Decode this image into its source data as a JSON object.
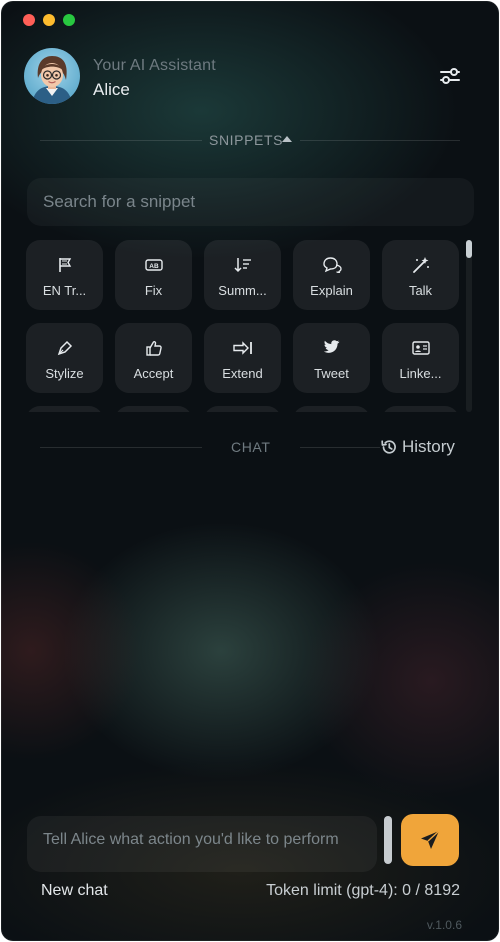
{
  "header": {
    "subtitle": "Your AI Assistant",
    "name": "Alice",
    "settings_icon": "sliders-icon"
  },
  "snippets": {
    "label": "SNIPPETS",
    "search_placeholder": "Search for a snippet",
    "items": [
      {
        "label": "EN Tr...",
        "icon": "flag-icon"
      },
      {
        "label": "Fix",
        "icon": "ab-icon"
      },
      {
        "label": "Summ...",
        "icon": "sort-icon"
      },
      {
        "label": "Explain",
        "icon": "chat-bubbles-icon"
      },
      {
        "label": "Talk",
        "icon": "magic-wand-icon"
      },
      {
        "label": "Stylize",
        "icon": "pen-icon"
      },
      {
        "label": "Accept",
        "icon": "thumbs-up-icon"
      },
      {
        "label": "Extend",
        "icon": "arrow-bar-right-icon"
      },
      {
        "label": "Tweet",
        "icon": "twitter-icon"
      },
      {
        "label": "Linke...",
        "icon": "id-card-icon"
      }
    ]
  },
  "chat": {
    "label": "CHAT",
    "history_label": "History",
    "input_placeholder": "Tell Alice what action you'd like to perform"
  },
  "footer": {
    "new_chat": "New chat",
    "token_limit": "Token limit (gpt-4): 0 / 8192",
    "version": "v.1.0.6"
  },
  "colors": {
    "accent": "#f0a53a",
    "background": "#0b1014"
  }
}
